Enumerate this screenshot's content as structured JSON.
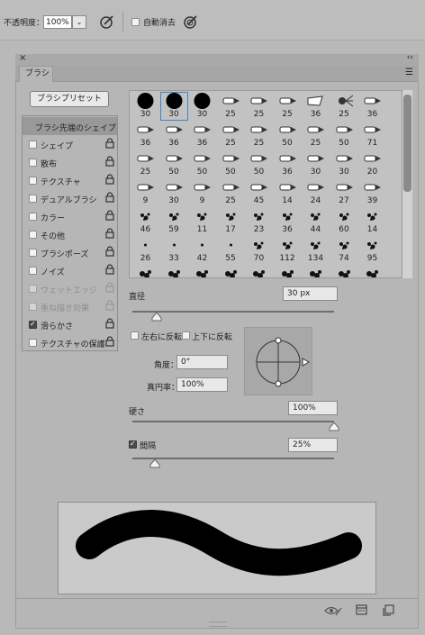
{
  "options_bar": {
    "opacity_label": "不透明度：",
    "opacity_value": "100%",
    "auto_erase_label": "自動消去"
  },
  "panel": {
    "tab_label": "ブラシ",
    "preset_button": "ブラシプリセット",
    "options": [
      {
        "label": "ブラシ先端のシェイプ",
        "header": true
      },
      {
        "label": "シェイプ",
        "checked": false,
        "lock": true
      },
      {
        "label": "散布",
        "checked": false,
        "lock": true
      },
      {
        "label": "テクスチャ",
        "checked": false,
        "lock": true
      },
      {
        "label": "デュアルブラシ",
        "checked": false,
        "lock": true
      },
      {
        "label": "カラー",
        "checked": false,
        "lock": true
      },
      {
        "label": "その他",
        "checked": false,
        "lock": true
      },
      {
        "label": "ブラシポーズ",
        "checked": false,
        "lock": true
      },
      {
        "label": "ノイズ",
        "checked": false,
        "lock": true
      },
      {
        "label": "ウェットエッジ",
        "checked": false,
        "lock": true,
        "disabled": true
      },
      {
        "label": "重ね描き効果",
        "checked": false,
        "lock": true,
        "disabled": true
      },
      {
        "label": "滑らかさ",
        "checked": true,
        "lock": true
      },
      {
        "label": "テクスチャの保護",
        "checked": false,
        "lock": true
      }
    ],
    "brush_sizes": [
      [
        "30",
        "30",
        "30",
        "25",
        "25",
        "25",
        "36",
        "25",
        "36"
      ],
      [
        "36",
        "36",
        "36",
        "25",
        "25",
        "50",
        "25",
        "50",
        "71"
      ],
      [
        "25",
        "50",
        "50",
        "50",
        "50",
        "36",
        "30",
        "30",
        "20"
      ],
      [
        "9",
        "30",
        "9",
        "25",
        "45",
        "14",
        "24",
        "27",
        "39"
      ],
      [
        "46",
        "59",
        "11",
        "17",
        "23",
        "36",
        "44",
        "60",
        "14"
      ],
      [
        "26",
        "33",
        "42",
        "55",
        "70",
        "112",
        "134",
        "74",
        "95"
      ],
      [
        "",
        "",
        "",
        "",
        "",
        "",
        "",
        "",
        ""
      ]
    ],
    "diameter_label": "直径",
    "diameter_value": "30 px",
    "flip_x_label": "左右に反転",
    "flip_y_label": "上下に反転",
    "angle_label": "角度：",
    "angle_value": "0°",
    "roundness_label": "真円率：",
    "roundness_value": "100%",
    "hardness_label": "硬さ",
    "hardness_value": "100%",
    "spacing_label": "間隔",
    "spacing_value": "25%",
    "spacing_checked": true,
    "diameter_slider": 0.12,
    "hardness_slider": 1.0,
    "spacing_slider": 0.11
  }
}
